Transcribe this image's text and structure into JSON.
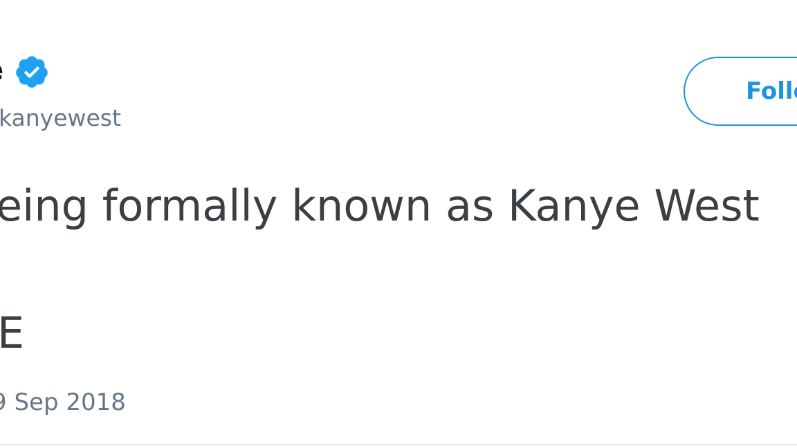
{
  "author": {
    "display_name_fragment": "e",
    "handle_fragment": "kanyewest",
    "verified_icon": "verified-badge-icon"
  },
  "follow_button": {
    "label_fragment": "Follo"
  },
  "tweet": {
    "text_line_1": "eing formally known as Kanye West",
    "text_line_2": "E",
    "timestamp_fragment": "9 Sep 2018"
  },
  "colors": {
    "accent": "#1b95e0",
    "secondary_text": "#657786",
    "body_text": "#3a3f44"
  }
}
